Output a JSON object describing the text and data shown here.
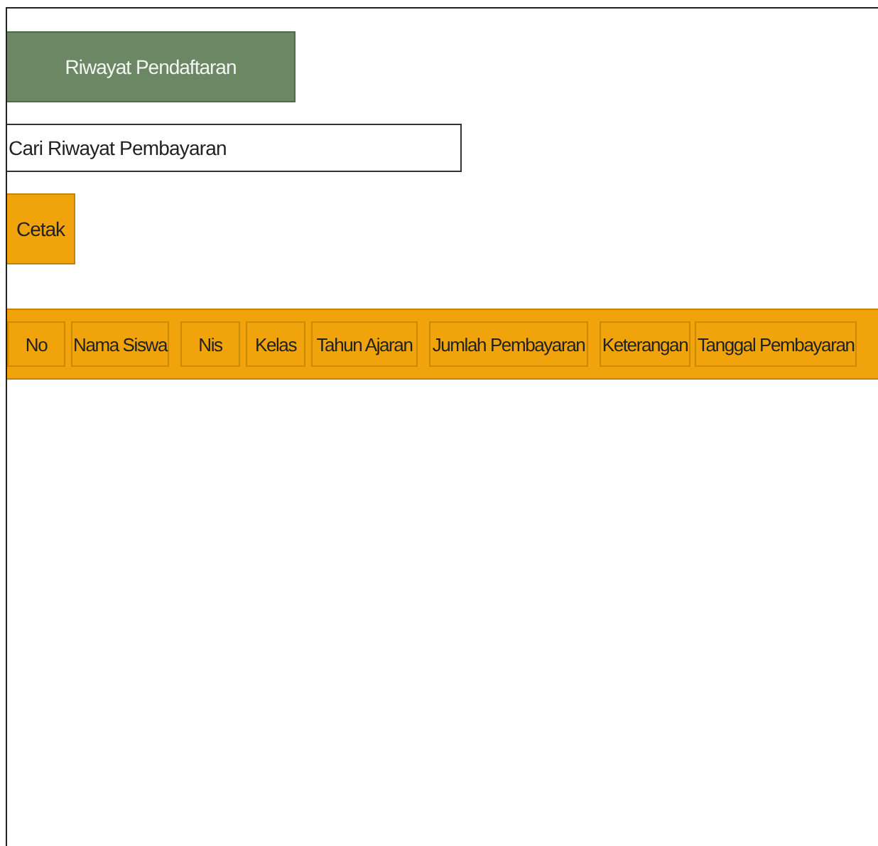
{
  "title_button": "Riwayat Pendaftaran",
  "search": {
    "placeholder": "Cari Riwayat Pembayaran"
  },
  "print_button": "Cetak",
  "table": {
    "columns": [
      "No",
      "Nama Siswa",
      "Nis",
      "Kelas",
      "Tahun Ajaran",
      "Jumlah Pembayaran",
      "Keterangan",
      "Tanggal Pembayaran"
    ]
  }
}
